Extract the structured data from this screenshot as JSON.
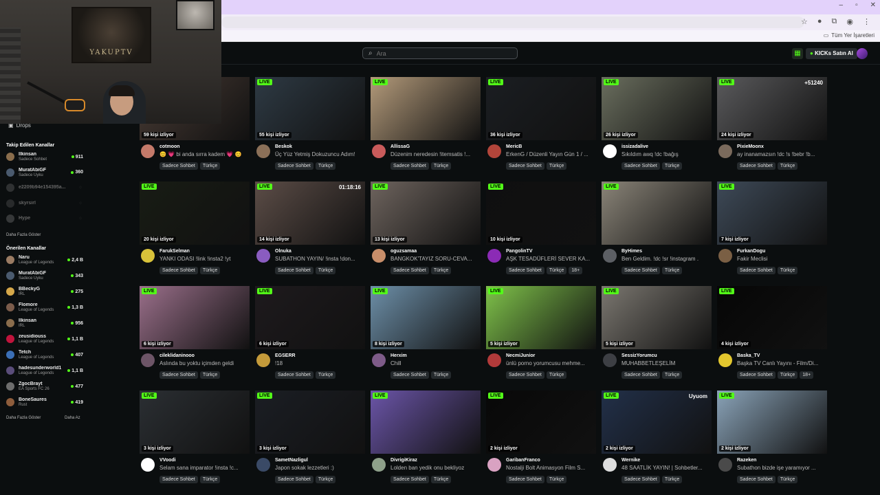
{
  "browser": {
    "bookmarks_all": "Tüm Yer İşaretleri",
    "window_controls": [
      "–",
      "▫",
      "✕"
    ]
  },
  "header": {
    "search_placeholder": "Ara",
    "kicks_label": "KICKs Satın Al"
  },
  "webcam": {
    "poster_text": "YAKUPTV"
  },
  "sidebar": {
    "drops": "Drops",
    "following_title": "Takip Edilen Kanallar",
    "following": [
      {
        "name": "İlkinsan",
        "category": "Sadece Sohbet",
        "viewers": "911",
        "online": true,
        "color": "#8a6d4c"
      },
      {
        "name": "MuratAbiGF",
        "category": "Sadece Uyku",
        "viewers": "360",
        "online": true,
        "color": "#4a5a6e"
      },
      {
        "name": "e2209b94e154395a...",
        "category": "",
        "viewers": "",
        "online": false,
        "color": "#666"
      },
      {
        "name": "skyrsirl",
        "category": "",
        "viewers": "",
        "online": false,
        "color": "#555"
      },
      {
        "name": "Hype",
        "category": "",
        "viewers": "",
        "online": false,
        "color": "#777"
      }
    ],
    "following_more": "Daha Fazla Göster",
    "recommended_title": "Önerilen Kanallar",
    "recommended": [
      {
        "name": "Naru",
        "category": "League of Legends",
        "viewers": "2,4 B",
        "color": "#9a7b63"
      },
      {
        "name": "MuratAbiGF",
        "category": "Sadece Uyku",
        "viewers": "343",
        "color": "#4a5a6e"
      },
      {
        "name": "BBeckyG",
        "category": "IRL",
        "viewers": "275",
        "color": "#d6a84a"
      },
      {
        "name": "Flomore",
        "category": "League of Legends",
        "viewers": "1,3 B",
        "color": "#7b5c4b"
      },
      {
        "name": "İlkinsan",
        "category": "IRL",
        "viewers": "956",
        "color": "#8a6d4c"
      },
      {
        "name": "zeusidiouss",
        "category": "League of Legends",
        "viewers": "1,1 B",
        "color": "#c0143c"
      },
      {
        "name": "Tetch",
        "category": "League of Legends",
        "viewers": "407",
        "color": "#3b6fb6"
      },
      {
        "name": "hadesunderworld1",
        "category": "League of Legends",
        "viewers": "1,1 B",
        "color": "#5a4d7a"
      },
      {
        "name": "ZgocBrayt",
        "category": "EA Sports FC 26",
        "viewers": "477",
        "color": "#6d6d6d"
      },
      {
        "name": "BoneSaures",
        "category": "Rust",
        "viewers": "419",
        "color": "#8e5d3c"
      }
    ],
    "rec_more": "Daha Fazla Göster",
    "rec_less": "Daha Az"
  },
  "streams": [
    {
      "name": "cotmoon",
      "title": "😊 💗 bi anda sırra kadem 💗 😊",
      "viewers": "59 kişi izliyor",
      "tags": [
        "Sadece Sohbet",
        "Türkçe"
      ],
      "thumb": "#4b3d36",
      "av": "#c47a6a",
      "thumb_text": ""
    },
    {
      "name": "Beskok",
      "title": "Üç Yüz Yetmiş Dokuzuncu Adım!",
      "viewers": "55 kişi izliyor",
      "tags": [
        "Sadece Sohbet",
        "Türkçe"
      ],
      "thumb": "#2e3a44",
      "av": "#8b7058",
      "thumb_text": ""
    },
    {
      "name": "AllissaG",
      "title": "Düzenim neredesin !itemsatis !...",
      "viewers": "",
      "tags": [
        "Sadece Sohbet",
        "Türkçe"
      ],
      "thumb": "#b39a7a",
      "av": "#c95b5b",
      "thumb_text": ""
    },
    {
      "name": "MericB",
      "title": "ErkenG / Düzenli Yayın Gün 1 / ...",
      "viewers": "36 kişi izliyor",
      "tags": [
        "Sadece Sohbet",
        "Türkçe"
      ],
      "thumb": "#1b1e22",
      "av": "#b2453a",
      "thumb_text": ""
    },
    {
      "name": "issizadalive",
      "title": "Sıkıldım awq !dc !bağış",
      "viewers": "26 kişi izliyor",
      "tags": [
        "Sadece Sohbet",
        "Türkçe"
      ],
      "thumb": "#6a6e5e",
      "av": "#ffffff",
      "thumb_text": ""
    },
    {
      "name": "PixieMoonx",
      "title": "ay inanamazsın !dc !s !bebr !b...",
      "viewers": "24 kişi izliyor",
      "tags": [
        "Sadece Sohbet",
        "Türkçe"
      ],
      "thumb": "#5a5a5c",
      "av": "#7a6a5c",
      "thumb_text": "+51240"
    },
    {
      "name": "FarukSelman",
      "title": "YANKI ODASI !link !insta2 !yt",
      "viewers": "20 kişi izliyor",
      "tags": [
        "Sadece Sohbet",
        "Türkçe"
      ],
      "thumb": "#181c14",
      "av": "#d8c23a",
      "thumb_text": ""
    },
    {
      "name": "Olnuka",
      "title": "SUBATHON YAYIN/ !insta !don...",
      "viewers": "14 kişi izliyor",
      "tags": [
        "Sadece Sohbet",
        "Türkçe"
      ],
      "thumb": "#5c4d47",
      "av": "#8a5cc0",
      "thumb_text": "01:18:16"
    },
    {
      "name": "oguzsamaa",
      "title": "BANGKOK'TAYIZ SORU-CEVA...",
      "viewers": "13 kişi izliyor",
      "tags": [
        "Sadece Sohbet",
        "Türkçe"
      ],
      "thumb": "#6e645e",
      "av": "#c88e6a",
      "thumb_text": ""
    },
    {
      "name": "PangolinTV",
      "title": "AŞK TESADÜFLERİ SEVER KA...",
      "viewers": "10 kişi izliyor",
      "tags": [
        "Sadece Sohbet",
        "Türkçe",
        "18+"
      ],
      "thumb": "#0f0f10",
      "av": "#8b2bb5",
      "thumb_text": ""
    },
    {
      "name": "ByHimes",
      "title": "Ben Geldim. !dc !sr !instagram .",
      "viewers": "",
      "tags": [
        "Sadece Sohbet",
        "Türkçe"
      ],
      "thumb": "#8a8478",
      "av": "#5c5f64",
      "thumb_text": ""
    },
    {
      "name": "FurkanDogu",
      "title": "Fakir Meclisi",
      "viewers": "7 kişi izliyor",
      "tags": [
        "Sadece Sohbet",
        "Türkçe"
      ],
      "thumb": "#3e4a58",
      "av": "#7a5f44",
      "thumb_text": ""
    },
    {
      "name": "cileklidaninooo",
      "title": "Aslında bu yoktu içimden geldi",
      "viewers": "6 kişi izliyor",
      "tags": [
        "Sadece Sohbet",
        "Türkçe"
      ],
      "thumb": "#9a6f8a",
      "av": "#6d5567",
      "thumb_text": ""
    },
    {
      "name": "EGSERR",
      "title": "!18",
      "viewers": "6 kişi izliyor",
      "tags": [
        "Sadece Sohbet",
        "Türkçe"
      ],
      "thumb": "#1e1a1d",
      "av": "#c49a3a",
      "thumb_text": ""
    },
    {
      "name": "Herxim",
      "title": "Chill",
      "viewers": "8 kişi izliyor",
      "tags": [
        "Sadece Sohbet",
        "Türkçe"
      ],
      "thumb": "#6d8fa8",
      "av": "#7e5b88",
      "thumb_text": ""
    },
    {
      "name": "NecmiJunior",
      "title": "ünlü porno yorumcusu mehme...",
      "viewers": "5 kişi izliyor",
      "tags": [
        "Sadece Sohbet",
        "Türkçe"
      ],
      "thumb": "#7fc24a",
      "av": "#b23a3a",
      "thumb_text": ""
    },
    {
      "name": "SessizYorumcu",
      "title": "MUHABBETLEŞELİM",
      "viewers": "5 kişi izliyor",
      "tags": [
        "Sadece Sohbet",
        "Türkçe"
      ],
      "thumb": "#7b7770",
      "av": "#3d3f44",
      "thumb_text": ""
    },
    {
      "name": "Baska_TV",
      "title": "Başka TV Canlı Yayını - Film/Di...",
      "viewers": "4 kişi izliyor",
      "tags": [
        "Sadece Sohbet",
        "Türkçe",
        "18+"
      ],
      "thumb": "#060606",
      "av": "#e3c72e",
      "thumb_text": ""
    },
    {
      "name": "VVoodi",
      "title": "Selam sana imparator !insta !c...",
      "viewers": "3 kişi izliyor",
      "tags": [
        "Sadece Sohbet",
        "Türkçe"
      ],
      "thumb": "#2b2f33",
      "av": "#ffffff",
      "thumb_text": ""
    },
    {
      "name": "SametNazligul",
      "title": "Japon sokak lezzetleri :)",
      "viewers": "3 kişi izliyor",
      "tags": [
        "Sadece Sohbet",
        "Türkçe"
      ],
      "thumb": "#1b1e24",
      "av": "#3a4a66",
      "thumb_text": ""
    },
    {
      "name": "DivrigiKiraz",
      "title": "Lolden ban yedik onu bekliyoz",
      "viewers": "",
      "tags": [
        "Sadece Sohbet",
        "Türkçe"
      ],
      "thumb": "#6b55a8",
      "av": "#8ea08a",
      "thumb_text": ""
    },
    {
      "name": "GaribanFranco",
      "title": "Nostalji Bolt Animasyon Film S...",
      "viewers": "2 kişi izliyor",
      "tags": [
        "Sadece Sohbet",
        "Türkçe"
      ],
      "thumb": "#080808",
      "av": "#d9a2c2",
      "thumb_text": ""
    },
    {
      "name": "Wernike",
      "title": "48 SAATLİK YAYIN! | Sohbetler...",
      "viewers": "2 kişi izliyor",
      "tags": [
        "Sadece Sohbet",
        "Türkçe"
      ],
      "thumb": "#223049",
      "av": "#dddddd",
      "thumb_text": "Uyuom"
    },
    {
      "name": "Razeken",
      "title": "Subathon bizde işe yaramıyor ...",
      "viewers": "2 kişi izliyor",
      "tags": [
        "Sadece Sohbet",
        "Türkçe"
      ],
      "thumb": "#8aa3b8",
      "av": "#4a4a4a",
      "thumb_text": ""
    }
  ],
  "live_label": "LIVE"
}
